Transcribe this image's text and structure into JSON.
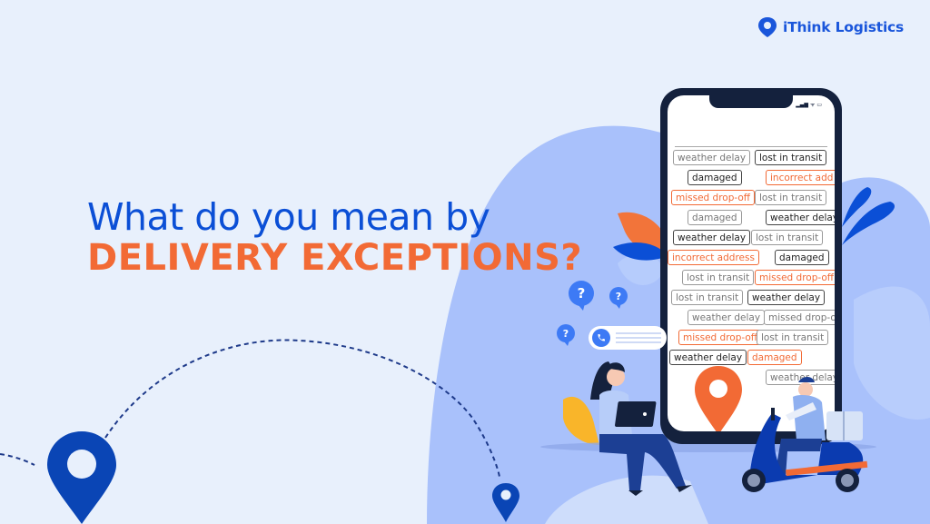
{
  "brand": {
    "name": "iThink Logistics",
    "icon": "location-pin-logo-icon"
  },
  "headline": {
    "line1": "What do you mean by",
    "line2": "DELIVERY EXCEPTIONS?"
  },
  "colors": {
    "primary_blue": "#0b4fd6",
    "accent_orange": "#f26a35",
    "background": "#e8f0fc",
    "blob": "#a9c1fb",
    "phone_frame": "#14213d"
  },
  "phone": {
    "status_icons": "▂▄▆ ᯤ ▭",
    "tags": [
      {
        "label": "weather delay",
        "style": "gray"
      },
      {
        "label": "lost in transit",
        "style": "dark"
      },
      {
        "label": "damaged",
        "style": "dark"
      },
      {
        "label": "incorrect add",
        "style": "orange"
      },
      {
        "label": "missed drop-off",
        "style": "orange"
      },
      {
        "label": "lost in transit",
        "style": "gray"
      },
      {
        "label": "damaged",
        "style": "gray"
      },
      {
        "label": "weather delay",
        "style": "dark"
      },
      {
        "label": "weather delay",
        "style": "dark"
      },
      {
        "label": "lost in transit",
        "style": "gray"
      },
      {
        "label": "incorrect address",
        "style": "orange"
      },
      {
        "label": "damaged",
        "style": "dark"
      },
      {
        "label": "lost in transit",
        "style": "gray"
      },
      {
        "label": "missed drop-off",
        "style": "orange"
      },
      {
        "label": "lost in transit",
        "style": "gray"
      },
      {
        "label": "weather delay",
        "style": "dark"
      },
      {
        "label": "weather delay",
        "style": "gray"
      },
      {
        "label": "missed drop-of",
        "style": "gray"
      },
      {
        "label": "missed drop-off",
        "style": "orange"
      },
      {
        "label": "lost in transit",
        "style": "gray"
      },
      {
        "label": "weather delay",
        "style": "dark"
      },
      {
        "label": "damaged",
        "style": "orange"
      },
      {
        "label": "weather delay",
        "style": "gray"
      }
    ]
  },
  "illustration": {
    "question_marks": [
      "?",
      "?",
      "?"
    ],
    "chat_icon": "phone-icon"
  }
}
